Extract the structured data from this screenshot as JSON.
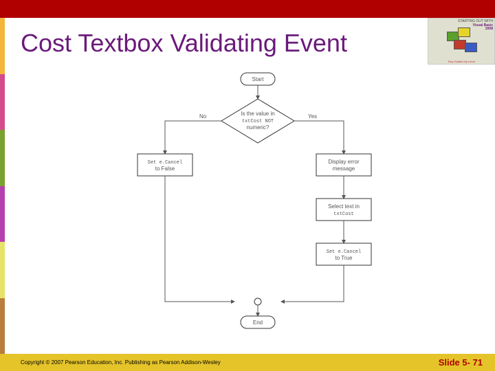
{
  "slide": {
    "title": "Cost Textbox Validating Event",
    "copyright": "Copyright © 2007 Pearson Education, Inc. Publishing as Pearson Addison-Wesley",
    "slide_number": "Slide 5- 71"
  },
  "flowchart": {
    "start": "Start",
    "decision_l1": "Is the value in",
    "decision_l2": "txtCost NOT",
    "decision_l3": "numeric?",
    "branch_no": "No",
    "branch_yes": "Yes",
    "no_box_l1": "Set e.Cancel",
    "no_box_l2": "to False",
    "yes_box1_l1": "Display error",
    "yes_box1_l2": "message",
    "yes_box2_l1": "Select text in",
    "yes_box2_l2": "txtCost",
    "yes_box3_l1": "Set e.Cancel",
    "yes_box3_l2": "to True",
    "end": "End"
  },
  "logo": {
    "line1": "STARTING OUT WITH",
    "line2": "Visual Basic",
    "line3": "2008",
    "sub": "Tony Gaddis   Kip Irvine"
  }
}
